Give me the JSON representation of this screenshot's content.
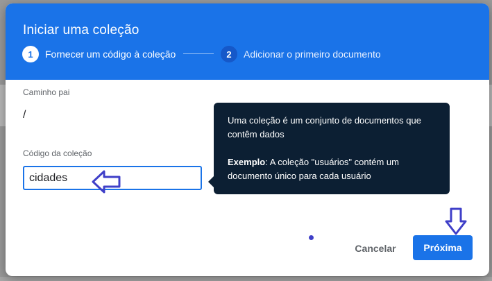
{
  "dialog": {
    "title": "Iniciar uma coleção",
    "steps": [
      {
        "number": "1",
        "label": "Fornecer um código à coleção",
        "active": true
      },
      {
        "number": "2",
        "label": "Adicionar o primeiro documento",
        "active": false
      }
    ]
  },
  "form": {
    "parent_path": {
      "label": "Caminho pai",
      "value": "/"
    },
    "collection_id": {
      "label": "Código da coleção",
      "value": "cidades"
    }
  },
  "tooltip": {
    "line1": "Uma coleção é um conjunto de documentos que contêm dados",
    "example_label": "Exemplo",
    "example_text": ": A coleção \"usuários\" contém um documento único para cada usuário"
  },
  "actions": {
    "cancel_label": "Cancelar",
    "next_label": "Próxima"
  },
  "colors": {
    "header": "#1a73e8",
    "primary_button": "#1a73e8",
    "tooltip_bg": "#0c1f33",
    "annotation": "#3f3fc8"
  },
  "icons": {
    "annotation_left": "arrow-left-icon",
    "annotation_down": "arrow-down-icon"
  }
}
